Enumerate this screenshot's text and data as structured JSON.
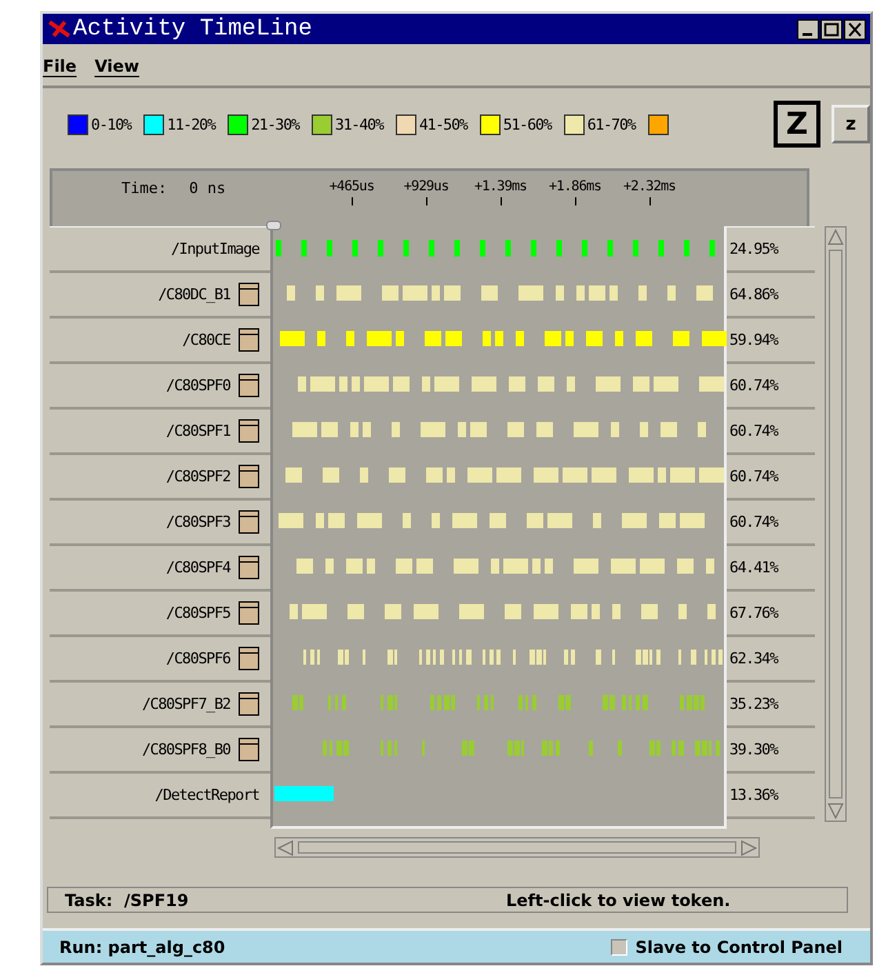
{
  "window": {
    "title": "Activity TimeLine"
  },
  "menu": [
    {
      "label": "File"
    },
    {
      "label": "View"
    }
  ],
  "legend": [
    {
      "label": "0-10%",
      "color": "#0000ff"
    },
    {
      "label": "11-20%",
      "color": "#00ffff"
    },
    {
      "label": "21-30%",
      "color": "#00ff00"
    },
    {
      "label": "31-40%",
      "color": "#9acd32"
    },
    {
      "label": "41-50%",
      "color": "#f0d8b0"
    },
    {
      "label": "51-60%",
      "color": "#ffff00"
    },
    {
      "label": "61-70%",
      "color": "#eee8aa"
    },
    {
      "color": "#ffa500"
    }
  ],
  "zoom_buttons": [
    {
      "label": "Z",
      "selected": true
    },
    {
      "label": "z",
      "selected": false
    }
  ],
  "ruler": {
    "time_label": "Time:",
    "time_value": "0 ns",
    "ticks": [
      "+465us",
      "+929us",
      "+1.39ms",
      "+1.86ms",
      "+2.32ms"
    ]
  },
  "rows": [
    {
      "name": "/InputImage",
      "folder": false,
      "percent": "24.95%",
      "color": "#00ff00",
      "kind": "ticks"
    },
    {
      "name": "/C80DC_B1",
      "folder": true,
      "percent": "64.86%",
      "color": "#eee8aa",
      "kind": "blocks"
    },
    {
      "name": "/C80CE",
      "folder": true,
      "percent": "59.94%",
      "color": "#ffff00",
      "kind": "blocks"
    },
    {
      "name": "/C80SPF0",
      "folder": true,
      "percent": "60.74%",
      "color": "#eee8aa",
      "kind": "blocks"
    },
    {
      "name": "/C80SPF1",
      "folder": true,
      "percent": "60.74%",
      "color": "#eee8aa",
      "kind": "blocks"
    },
    {
      "name": "/C80SPF2",
      "folder": true,
      "percent": "60.74%",
      "color": "#eee8aa",
      "kind": "blocks"
    },
    {
      "name": "/C80SPF3",
      "folder": true,
      "percent": "60.74%",
      "color": "#eee8aa",
      "kind": "blocks"
    },
    {
      "name": "/C80SPF4",
      "folder": true,
      "percent": "64.41%",
      "color": "#eee8aa",
      "kind": "blocks"
    },
    {
      "name": "/C80SPF5",
      "folder": true,
      "percent": "67.76%",
      "color": "#eee8aa",
      "kind": "blocks"
    },
    {
      "name": "/C80SPF6",
      "folder": true,
      "percent": "62.34%",
      "color": "#eee8aa",
      "kind": "slivers"
    },
    {
      "name": "/C80SPF7_B2",
      "folder": true,
      "percent": "35.23%",
      "color": "#9acd32",
      "kind": "slivers"
    },
    {
      "name": "/C80SPF8_B0",
      "folder": true,
      "percent": "39.30%",
      "color": "#9acd32",
      "kind": "slivers"
    },
    {
      "name": "/DetectReport",
      "folder": false,
      "percent": "13.36%",
      "color": "#00ffff",
      "kind": "burst"
    }
  ],
  "task_bar": {
    "task": "Task:  /SPF19",
    "hint": "Left-click to view token."
  },
  "status_bar": {
    "run": "Run: part_alg_c80",
    "slave_checkbox": {
      "label": "Slave to Control Panel",
      "checked": false
    }
  }
}
